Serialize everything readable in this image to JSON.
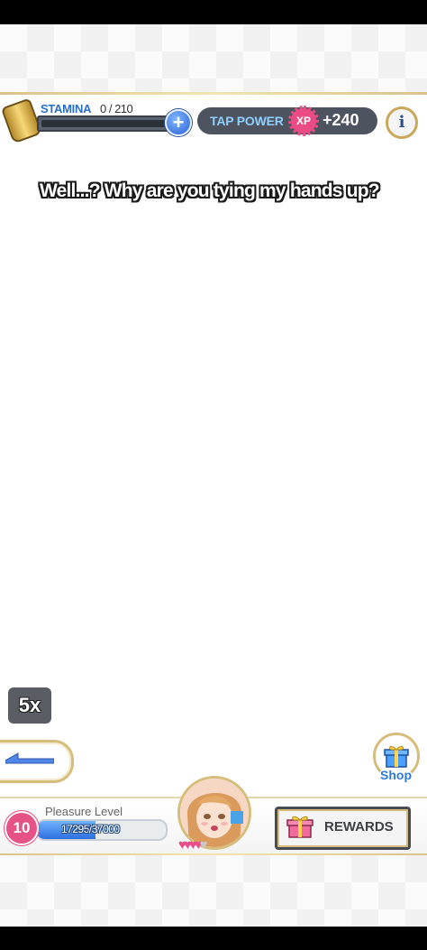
{
  "hud": {
    "stamina_label": "STAMINA",
    "stamina_value": "0 / 210",
    "stamina_fraction": 0,
    "tap_power_label": "TAP POWER",
    "xp_badge": "XP",
    "tap_power_value": "+240",
    "info_label": "i"
  },
  "dialogue": {
    "text": "Well...? Why are you tying my hands up?"
  },
  "controls": {
    "speed_label": "5x",
    "shop_label": "Shop"
  },
  "progress": {
    "pleasure_label": "Pleasure Level",
    "level": "10",
    "current": "17295",
    "separator": "/",
    "max": "37000",
    "fraction": 0.467,
    "hearts_filled": 4,
    "hearts_total": 5
  },
  "rewards": {
    "label": "REWARDS"
  },
  "colors": {
    "accent_gold": "#d6bd7c",
    "accent_pink": "#e65285",
    "accent_blue": "#2d6fe0"
  }
}
